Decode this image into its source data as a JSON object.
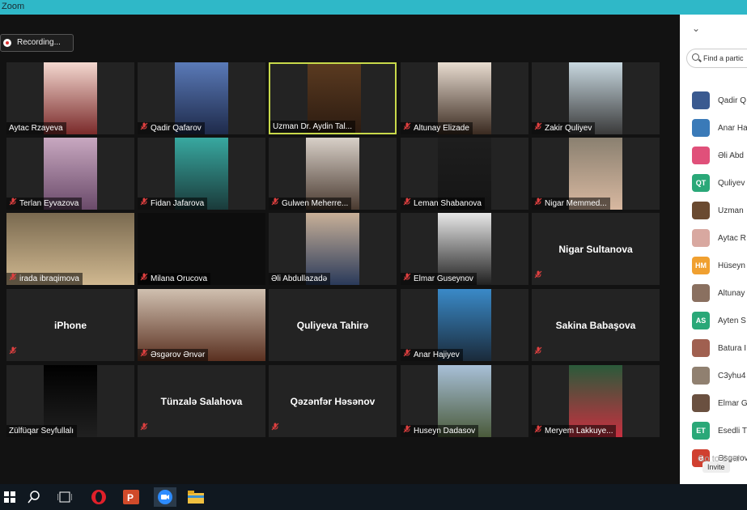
{
  "window": {
    "title": "Zoom"
  },
  "recording": {
    "label": "Recording..."
  },
  "tiles": [
    {
      "name": "Aytac Rzayeva",
      "muted": false,
      "photo": [
        "#f4d8d0",
        "#7a2a2a"
      ]
    },
    {
      "name": "Qadir Qafarov",
      "muted": true,
      "photo": [
        "#5a7ab8",
        "#1e2a4a"
      ]
    },
    {
      "name": "Uzman Dr. Aydin Tal...",
      "muted": false,
      "active": true,
      "photo": [
        "#5a3a20",
        "#2a1a10"
      ]
    },
    {
      "name": "Altunay Elizade",
      "muted": true,
      "photo": [
        "#e8dcd0",
        "#3a2a20"
      ]
    },
    {
      "name": "Zakir Quliyev",
      "muted": true,
      "photo": [
        "#c8d8e0",
        "#3a3a3a"
      ]
    },
    {
      "name": "Terlan Eyvazova",
      "muted": true,
      "photo": [
        "#c8a8c0",
        "#6a4a6a"
      ]
    },
    {
      "name": "Fidan Jafarova",
      "muted": true,
      "photo": [
        "#38a8a0",
        "#1a3a3a"
      ]
    },
    {
      "name": "Gulwen Meherre...",
      "muted": true,
      "photo": [
        "#d8d0c8",
        "#4a3a30"
      ]
    },
    {
      "name": "Leman Shabanova",
      "muted": true,
      "photo": [
        "#1e1e1e",
        "#151515"
      ]
    },
    {
      "name": "Nigar Memmed...",
      "muted": true,
      "photo": [
        "#8a8070",
        "#d8b8a0"
      ]
    },
    {
      "name": "irada ibraqimova",
      "muted": true,
      "photo": [
        "#7a6a50",
        "#d0b890"
      ],
      "wide": true
    },
    {
      "name": "Milana Orucova",
      "muted": true,
      "photo": null,
      "dark": true
    },
    {
      "name": "Əli Abdullazadə",
      "muted": false,
      "photo": [
        "#c8b098",
        "#2a3a5a"
      ]
    },
    {
      "name": "Elmar Guseynov",
      "muted": true,
      "photo": [
        "#e8e8e8",
        "#202020"
      ]
    },
    {
      "name": "Nigar Sultanova",
      "muted": true,
      "photo": null,
      "big": true
    },
    {
      "name": "iPhone",
      "muted": true,
      "photo": null,
      "big": true
    },
    {
      "name": "Əsgərov Ənvər",
      "muted": true,
      "photo": [
        "#d0c0b0",
        "#5a3020"
      ],
      "wide": true
    },
    {
      "name": "Quliyeva Tahirə",
      "muted": false,
      "photo": null,
      "big": true
    },
    {
      "name": "Anar Hajiyev",
      "muted": true,
      "photo": [
        "#3a8ac8",
        "#1a2a3a"
      ]
    },
    {
      "name": "Sakina Babaşova",
      "muted": true,
      "photo": null,
      "big": true
    },
    {
      "name": "Zülfüqar Seyfullalı",
      "muted": false,
      "photo": [
        "#000000",
        "#202020"
      ]
    },
    {
      "name": "Tünzalə Salahova",
      "muted": true,
      "photo": null,
      "big": true
    },
    {
      "name": "Qəzənfər Həsənov",
      "muted": true,
      "photo": null,
      "big": true
    },
    {
      "name": "Huseyn Dadasov",
      "muted": true,
      "photo": [
        "#a8c0d8",
        "#4a5a3a"
      ]
    },
    {
      "name": "Meryem Lakkuye...",
      "muted": true,
      "photo": [
        "#2a5a3a",
        "#c83040"
      ]
    }
  ],
  "panel": {
    "collapse_icon": "chevron-down-icon",
    "search_placeholder": "Find a partic",
    "participants": [
      {
        "name": "Qadir Q",
        "avatar": "",
        "color": "#3a5a90"
      },
      {
        "name": "Anar Ha",
        "avatar": "",
        "color": "#3a7ab8"
      },
      {
        "name": "Əli Abd",
        "avatar": "",
        "color": "#e0507a"
      },
      {
        "name": "Quliyev",
        "avatar": "QT",
        "color": "#2aa878"
      },
      {
        "name": "Uzman",
        "avatar": "",
        "color": "#6a4a30"
      },
      {
        "name": "Aytac R",
        "avatar": "",
        "color": "#d8a8a0"
      },
      {
        "name": "Hüseyn",
        "avatar": "HM",
        "color": "#f0a030"
      },
      {
        "name": "Altunay",
        "avatar": "",
        "color": "#8a7060"
      },
      {
        "name": "Ayten S",
        "avatar": "AS",
        "color": "#2aa878"
      },
      {
        "name": "Batura I",
        "avatar": "",
        "color": "#a06050"
      },
      {
        "name": "C3yhu4",
        "avatar": "",
        "color": "#908070"
      },
      {
        "name": "Elmar G",
        "avatar": "",
        "color": "#6a5040"
      },
      {
        "name": "Esedli T",
        "avatar": "ET",
        "color": "#2aa878"
      },
      {
        "name": "Əsgərov",
        "avatar": "Ə",
        "color": "#d04030"
      }
    ],
    "footer_text": "Go to Setti",
    "invite_label": "Invite"
  }
}
